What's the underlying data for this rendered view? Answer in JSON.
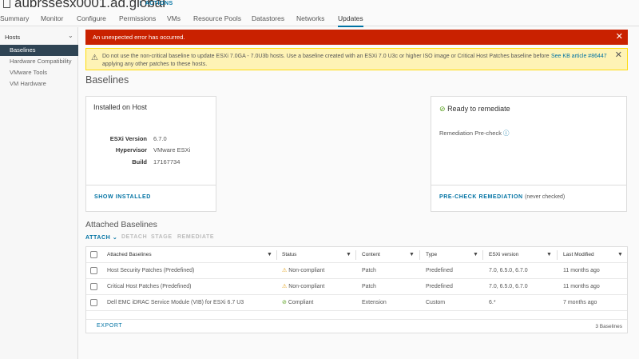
{
  "header": {
    "title": "aubrssesx0001.ad.global",
    "actions": "ACTIONS"
  },
  "tabs": [
    "Summary",
    "Monitor",
    "Configure",
    "Permissions",
    "VMs",
    "Resource Pools",
    "Datastores",
    "Networks",
    "Updates"
  ],
  "sidebar": {
    "group": "Hosts",
    "items": [
      "Baselines",
      "Hardware Compatibility",
      "VMware Tools",
      "VM Hardware"
    ]
  },
  "error": {
    "text": "An unexpected error has occurred."
  },
  "warning": {
    "text": "Do not use the non-critical baseline to update ESXi 7.0GA - 7.0U3b hosts. Use a baseline created with an ESXi 7.0 U3c or higher ISO image or Critical Host Patches baseline before applying any other patches to these hosts.",
    "link": "See KB article #86447"
  },
  "page_title": "Baselines",
  "installed": {
    "title": "Installed on Host",
    "rows": [
      {
        "k": "ESXi Version",
        "v": "6.7.0"
      },
      {
        "k": "Hypervisor",
        "v": "VMware ESXi"
      },
      {
        "k": "Build",
        "v": "17167734"
      }
    ],
    "link": "SHOW INSTALLED"
  },
  "remediate": {
    "title": "Ready to remediate",
    "precheck": "Remediation Pre-check",
    "link": "PRE-CHECK REMEDIATION",
    "never": "(never checked)"
  },
  "attached": {
    "title": "Attached Baselines",
    "actions": [
      "ATTACH",
      "DETACH",
      "STAGE",
      "REMEDIATE"
    ],
    "columns": [
      "Attached Baselines",
      "Status",
      "Content",
      "Type",
      "ESXi version",
      "Last Modified"
    ],
    "rows": [
      {
        "name": "Host Security Patches (Predefined)",
        "status": "Non-compliant",
        "content": "Patch",
        "type": "Predefined",
        "esxi": "7.0, 6.5.0, 6.7.0",
        "modified": "11 months ago"
      },
      {
        "name": "Critical Host Patches (Predefined)",
        "status": "Non-compliant",
        "content": "Patch",
        "type": "Predefined",
        "esxi": "7.0, 6.5.0, 6.7.0",
        "modified": "11 months ago"
      },
      {
        "name": "Dell EMC iDRAC Service Module (VIB) for ESXi 6.7 U3",
        "status": "Compliant",
        "content": "Extension",
        "type": "Custom",
        "esxi": "6.*",
        "modified": "7 months ago"
      }
    ],
    "export": "EXPORT",
    "count": "3 Baselines"
  }
}
